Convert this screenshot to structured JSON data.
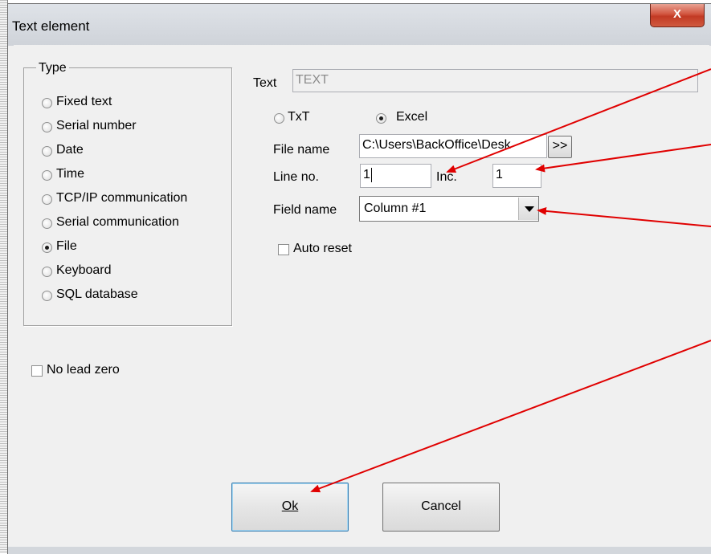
{
  "window": {
    "title": "Text element",
    "close_glyph": "X"
  },
  "type_group": {
    "legend": "Type",
    "options": [
      {
        "label": "Fixed text",
        "checked": false
      },
      {
        "label": "Serial number",
        "checked": false
      },
      {
        "label": "Date",
        "checked": false
      },
      {
        "label": "Time",
        "checked": false
      },
      {
        "label": "TCP/IP communication",
        "checked": false
      },
      {
        "label": "Serial communication",
        "checked": false
      },
      {
        "label": "File",
        "checked": true
      },
      {
        "label": "Keyboard",
        "checked": false
      },
      {
        "label": "SQL database",
        "checked": false
      }
    ]
  },
  "no_lead_zero": {
    "label": "No lead zero",
    "checked": false
  },
  "text_field": {
    "label": "Text",
    "value": "TEXT"
  },
  "source": {
    "txt_label": "TxT",
    "txt_checked": false,
    "excel_label": "Excel",
    "excel_checked": true
  },
  "file_name": {
    "label": "File name",
    "value": "C:\\Users\\BackOffice\\Desk",
    "browse_label": ">>"
  },
  "line_no": {
    "label": "Line no.",
    "value": "1"
  },
  "inc": {
    "label": "Inc.",
    "value": "1"
  },
  "field_name": {
    "label": "Field name",
    "value": "Column #1"
  },
  "auto_reset": {
    "label": "Auto reset",
    "checked": false
  },
  "buttons": {
    "ok_label": "Ok",
    "cancel_label": "Cancel"
  },
  "colors": {
    "annotation_arrow": "#e00000",
    "close_button": "#c94a33"
  }
}
